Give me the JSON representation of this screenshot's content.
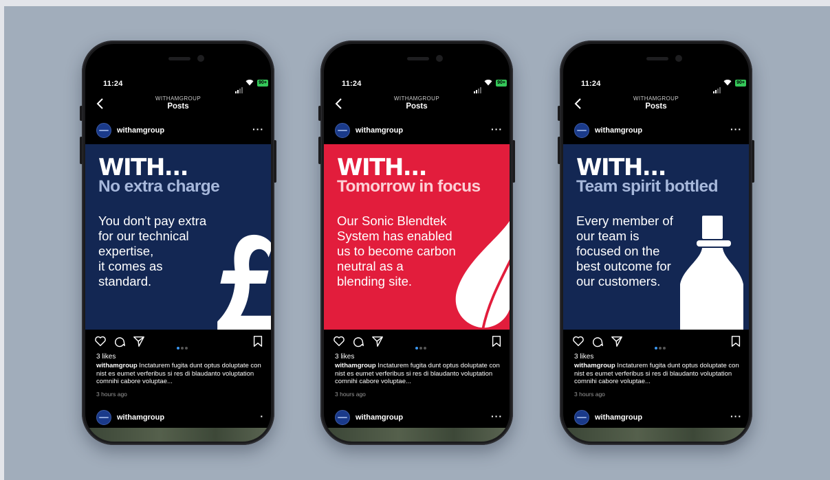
{
  "phones": [
    {
      "time": "11:24",
      "battery": "90+",
      "nav_subtitle": "WITHAMGROUP",
      "nav_title": "Posts",
      "username": "withamgroup",
      "more": "···",
      "creative": {
        "background": "#132753",
        "headline": "WITH...",
        "tagline": "No extra charge",
        "tagline_color": "#a7b8db",
        "body": "You don't pay extra\nfor our technical\nexpertise,\nit comes as\nstandard.",
        "art_icon": "pound-sign-icon"
      },
      "likes": "3 likes",
      "caption_user": "withamgroup",
      "caption_text": "Inctaturem fugita dunt optus doluptate con nist es eumet verferibus si res di blaudanto voluptation comnihi cabore voluptae...",
      "time_ago": "3 hours ago",
      "next_username": "withamgroup",
      "next_more": "·"
    },
    {
      "time": "11:24",
      "battery": "90+",
      "nav_subtitle": "WITHAMGROUP",
      "nav_title": "Posts",
      "username": "withamgroup",
      "more": "···",
      "creative": {
        "background": "#e21d3c",
        "headline": "WITH...",
        "tagline": "Tomorrow in focus",
        "tagline_color": "#fcd0d6",
        "body": "Our Sonic Blendtek\nSystem has enabled\nus to become carbon\nneutral as a\nblending site.",
        "art_icon": "leaf-icon"
      },
      "likes": "3 likes",
      "caption_user": "withamgroup",
      "caption_text": "Inctaturem fugita dunt optus doluptate con nist es eumet verferibus si res di blaudanto voluptation comnihi cabore voluptae...",
      "time_ago": "3 hours ago",
      "next_username": "withamgroup",
      "next_more": "···"
    },
    {
      "time": "11:24",
      "battery": "90+",
      "nav_subtitle": "WITHAMGROUP",
      "nav_title": "Posts",
      "username": "withamgroup",
      "more": "···",
      "creative": {
        "background": "#132753",
        "headline": "WITH...",
        "tagline": "Team spirit bottled",
        "tagline_color": "#a7b8db",
        "body": "Every member of\nour team is\nfocused on the\nbest outcome for\nour customers.",
        "art_icon": "bottle-icon"
      },
      "likes": "3 likes",
      "caption_user": "withamgroup",
      "caption_text": "Inctaturem fugita dunt optus doluptate con nist es eumet verferibus si res di blaudanto voluptation comnihi cabore voluptae...",
      "time_ago": "3 hours ago",
      "next_username": "withamgroup",
      "next_more": "···"
    }
  ]
}
